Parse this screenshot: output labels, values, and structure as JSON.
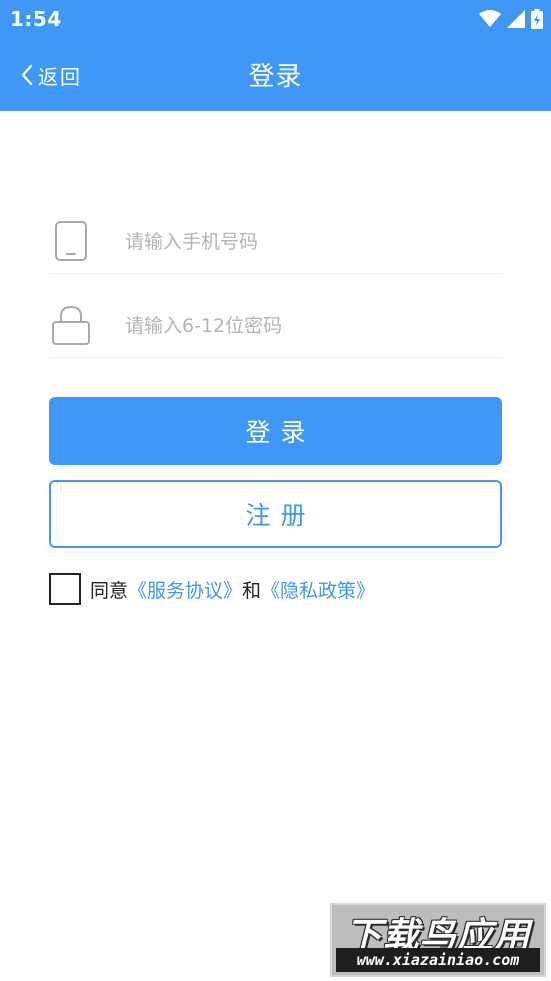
{
  "status_bar": {
    "time": "1:54",
    "background_color": "#3f97f6",
    "icons": [
      "wifi-icon",
      "cellular-signal-icon",
      "battery-charging-icon"
    ]
  },
  "app_bar": {
    "back_label": "返回",
    "title": "登录",
    "background_color": "#3f97f6"
  },
  "form": {
    "phone": {
      "icon": "phone-icon",
      "placeholder": "请输入手机号码",
      "value": ""
    },
    "password": {
      "icon": "lock-icon",
      "placeholder": "请输入6-12位密码",
      "value": ""
    },
    "login_label": "登录",
    "register_label": "注册",
    "accent_color": "#3f97f6"
  },
  "agreement": {
    "checked": false,
    "prefix": "同意",
    "service_link": "《服务协议》",
    "conjunction": "和",
    "privacy_link": "《隐私政策》"
  },
  "watermark": {
    "logo_text": "下载鸟应用",
    "url_text": "www.xiazainiao.com"
  }
}
